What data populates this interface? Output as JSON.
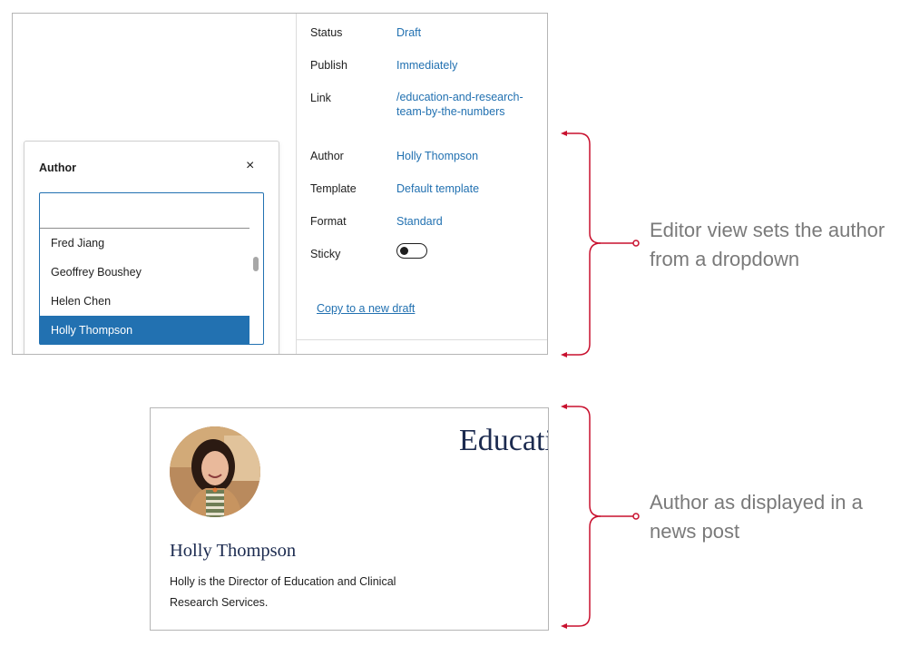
{
  "editor": {
    "author_popover": {
      "title": "Author",
      "close_glyph": "×",
      "search_value": "",
      "options": [
        "Fred Jiang",
        "Geoffrey Boushey",
        "Helen Chen",
        "Holly Thompson"
      ],
      "selected_option": "Holly Thompson"
    },
    "properties": {
      "status": {
        "label": "Status",
        "value": "Draft"
      },
      "publish": {
        "label": "Publish",
        "value": "Immediately"
      },
      "link": {
        "label": "Link",
        "value": "/education-and-research-team-by-the-numbers"
      },
      "author": {
        "label": "Author",
        "value": "Holly Thompson"
      },
      "template": {
        "label": "Template",
        "value": "Default template"
      },
      "format": {
        "label": "Format",
        "value": "Standard"
      },
      "sticky": {
        "label": "Sticky",
        "toggle_on": false
      }
    },
    "copy_link": "Copy to a new draft",
    "accent_color": "#2271b1"
  },
  "post": {
    "title": "Education and Research Team by the Numbers",
    "author_name": "Holly Thompson",
    "author_bio": "Holly is the Director of Education and Clinical Research Services.",
    "title_color": "#1b2a4f"
  },
  "annotations": {
    "editor_note": "Editor view sets the author from a dropdown",
    "post_note": "Author as displayed in a news post",
    "bracket_color": "#c8102e"
  }
}
